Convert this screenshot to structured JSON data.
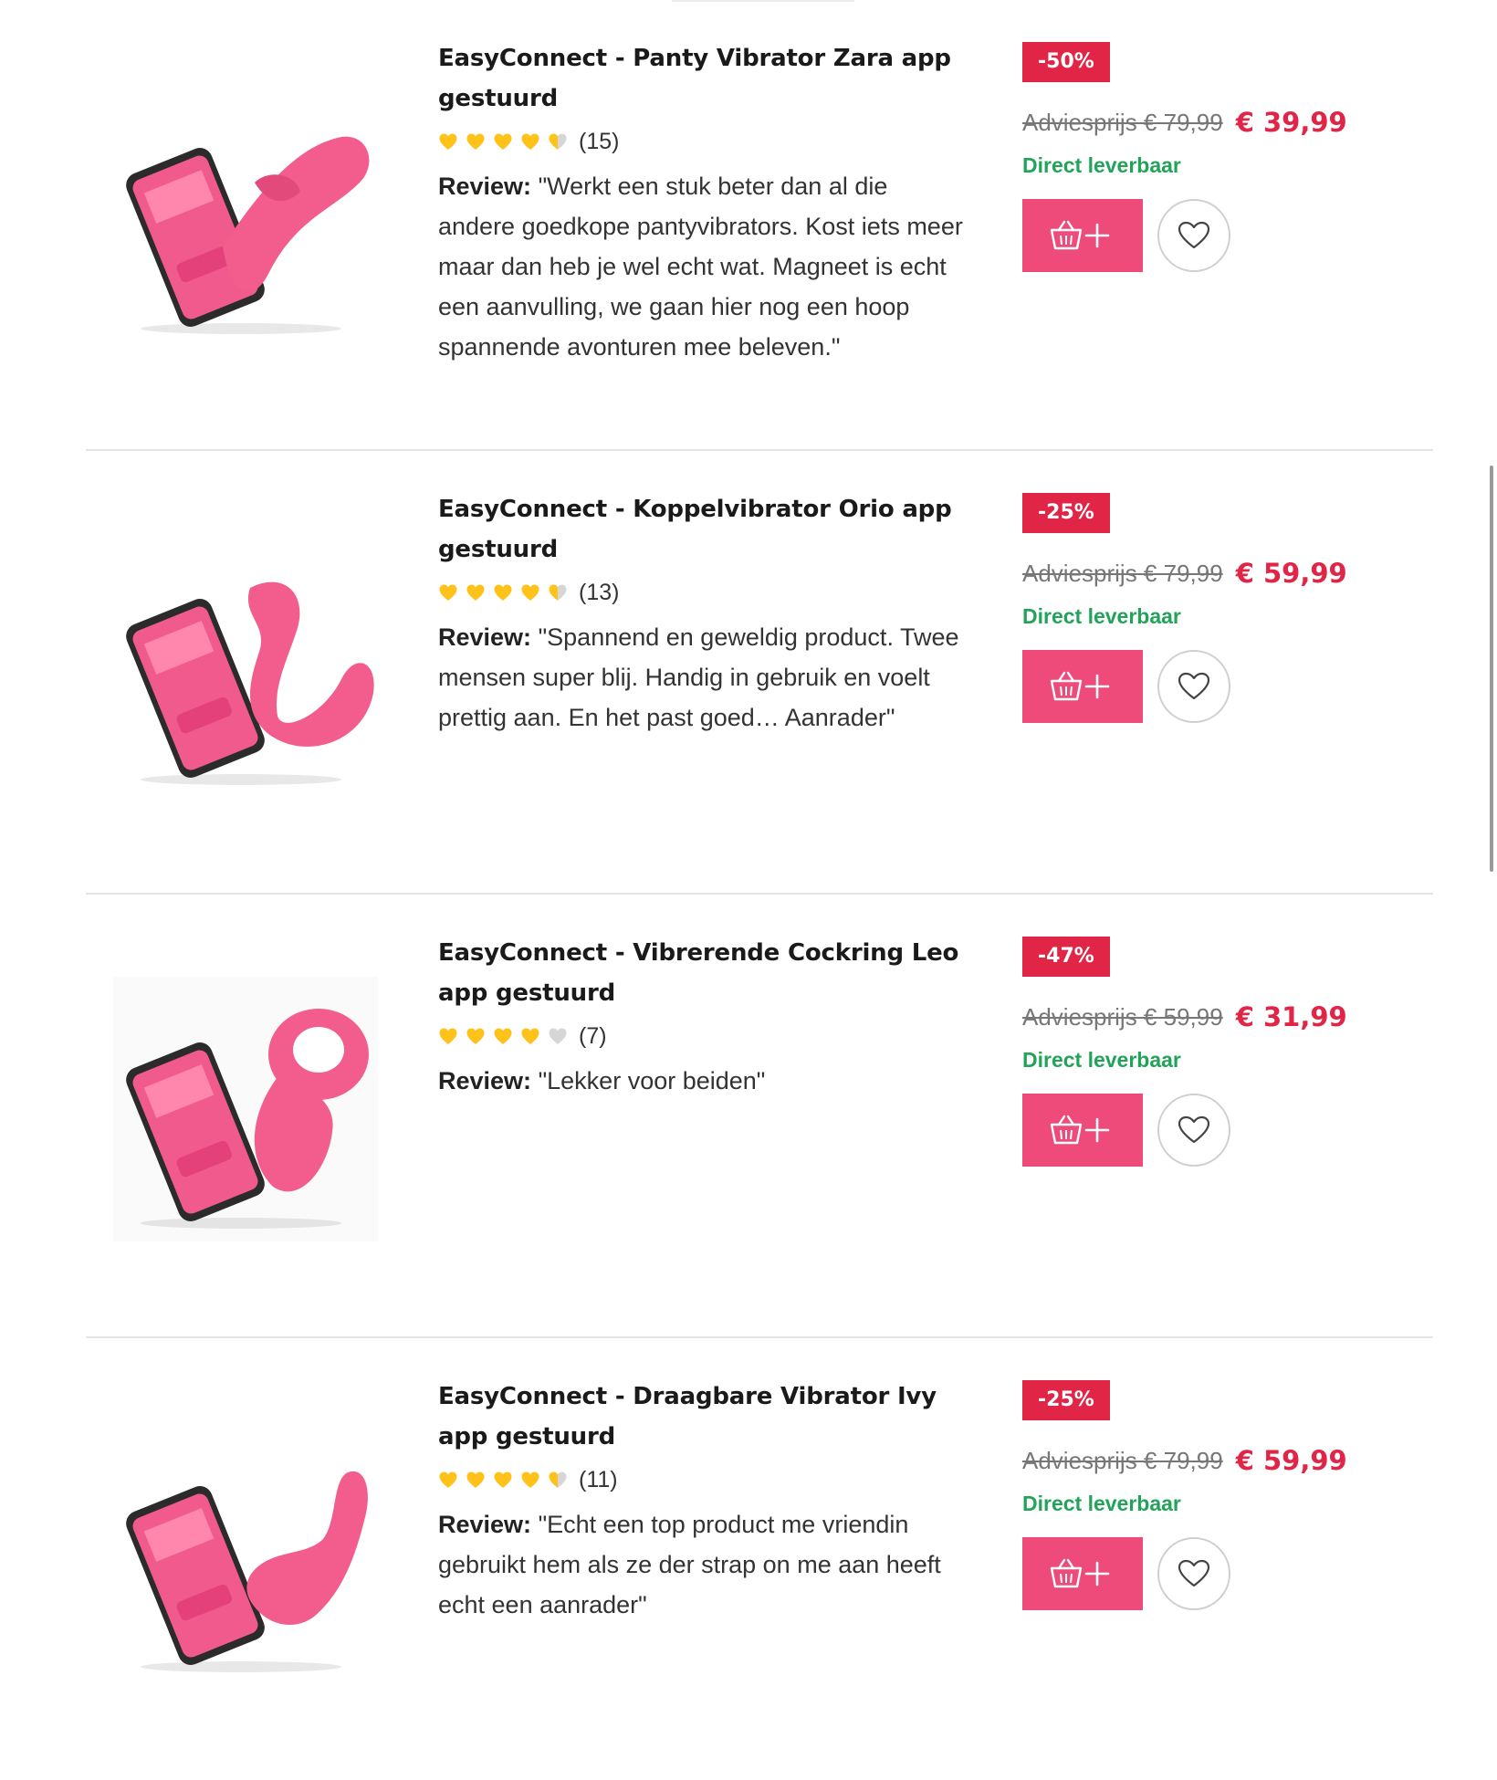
{
  "products": [
    {
      "title": "EasyConnect - Panty Vibrator Zara app gestuurd",
      "rating_stars": 4.5,
      "rating_count": "(15)",
      "review_label": "Review:",
      "review_text": "\"Werkt een stuk beter dan al die andere goedkope pantyvibrators. Kost iets meer maar dan heb je wel echt wat. Magneet is echt een aanvulling, we gaan hier nog een hoop spannende avonturen mee beleven.\"",
      "discount": "-50%",
      "old_price": "Adviesprijs € 79,99",
      "new_price": "€ 39,99",
      "availability": "Direct leverbaar",
      "image_icon": "panty-vibrator-with-phone"
    },
    {
      "title": "EasyConnect - Koppelvibrator Orio app gestuurd",
      "rating_stars": 4.5,
      "rating_count": "(13)",
      "review_label": "Review:",
      "review_text": "\"Spannend en geweldig product. Twee mensen super blij. Handig in gebruik en voelt prettig aan. En het past goed… Aanrader\"",
      "discount": "-25%",
      "old_price": "Adviesprijs € 79,99",
      "new_price": "€ 59,99",
      "availability": "Direct leverbaar",
      "image_icon": "couples-vibrator-with-phone"
    },
    {
      "title": "EasyConnect - Vibrerende Cockring Leo app gestuurd",
      "rating_stars": 4,
      "rating_count": "(7)",
      "review_label": "Review:",
      "review_text": "\"Lekker voor beiden\"",
      "discount": "-47%",
      "old_price": "Adviesprijs € 59,99",
      "new_price": "€ 31,99",
      "availability": "Direct leverbaar",
      "image_icon": "cockring-with-phone"
    },
    {
      "title": "EasyConnect - Draagbare Vibrator Ivy app gestuurd",
      "rating_stars": 4.5,
      "rating_count": "(11)",
      "review_label": "Review:",
      "review_text": "\"Echt een top product me vriendin gebruikt hem als ze der strap on me aan heeft echt een aanrader\"",
      "discount": "-25%",
      "old_price": "Adviesprijs € 79,99",
      "new_price": "€ 59,99",
      "availability": "Direct leverbaar",
      "image_icon": "wearable-vibrator-with-phone"
    }
  ],
  "icons": {
    "cart": "basket-plus-icon",
    "favorite": "heart-outline-icon",
    "rating": "heart-rating-icon"
  },
  "colors": {
    "accent_pink": "#ee4b7a",
    "discount_red": "#e02546",
    "price_red": "#e02546",
    "availability_green": "#21a35a",
    "rating_gold": "#ffc21a",
    "rating_empty": "#d6d6d6"
  }
}
